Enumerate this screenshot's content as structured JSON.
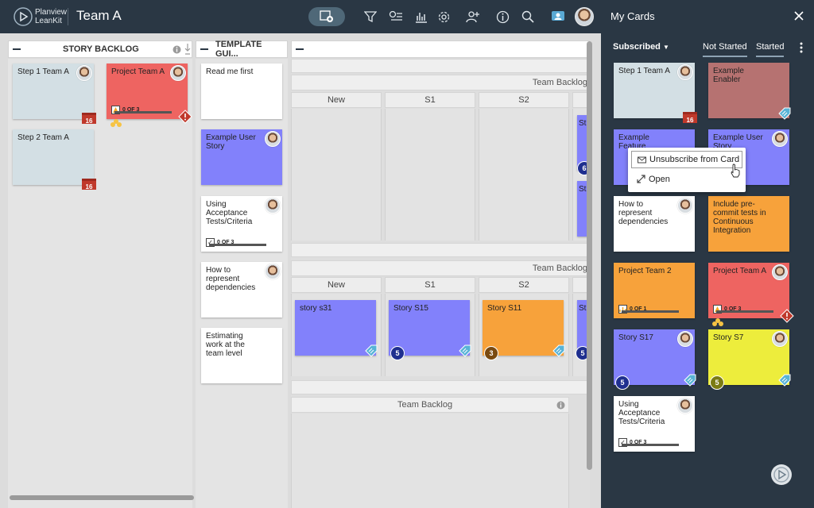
{
  "topbar": {
    "brand_line1": "Planview",
    "brand_line2": "LeanKit",
    "board_title": "Team A"
  },
  "colors": {
    "topbar": "#2a3744",
    "card_grey": "#d3dfe4",
    "card_red": "#ee6461",
    "card_purple": "#8281fb",
    "card_orange": "#f7a23b",
    "card_yellow": "#eded3c",
    "card_mauve": "#b67271",
    "card_white": "#ffffff"
  },
  "lanes": {
    "story_backlog": "STORY BACKLOG",
    "template_guide": "TEMPLATE GUI...",
    "team_backlog_top": "Team Backlog",
    "team_backlog_mid": "Team Backlog",
    "team_backlog_bottom": "Team Backlog",
    "columns_top": [
      "New",
      "S1",
      "S2"
    ],
    "columns_mid": [
      "New",
      "S1",
      "S2"
    ]
  },
  "board_cards": {
    "step1": "Step 1 Team A",
    "project_a": "Project Team A",
    "project_a_progress": "0 OF 3",
    "step2": "Step 2 Team A",
    "date16": "16",
    "read_me": "Read me first",
    "example_story": "Example User Story",
    "acceptance": "Using Acceptance Tests/Criteria",
    "acceptance_progress": "0 OF 3",
    "represent": "How to represent dependencies",
    "estimating": "Estimating work at the team level",
    "story_s31": "story s31",
    "story_s15": "Story S15",
    "story_s11": "Story S11",
    "level5": "5",
    "level3": "3",
    "level6": "6",
    "partial_st": "St"
  },
  "panel": {
    "title": "My Cards",
    "filter": "Subscribed",
    "tab_not_started": "Not Started",
    "tab_started": "Started",
    "cards": {
      "step1": "Step 1 Team A",
      "enabler": "Example Enabler",
      "feature": "Example Feature",
      "user_story": "Example User Story",
      "represent": "How to represent dependencies",
      "precommit": "Include pre-commit tests in Continuous Integration",
      "project2": "Project Team 2",
      "project2_progress": "0 OF 1",
      "project_a": "Project Team A",
      "project_a_progress": "0 OF 3",
      "s17": "Story S17",
      "s7": "Story S7",
      "acceptance": "Using Acceptance Tests/Criteria",
      "acceptance_progress": "0 OF 3",
      "date16": "16",
      "level5": "5"
    },
    "menu": {
      "unsubscribe": "Unsubscribe from Card",
      "open": "Open"
    }
  }
}
